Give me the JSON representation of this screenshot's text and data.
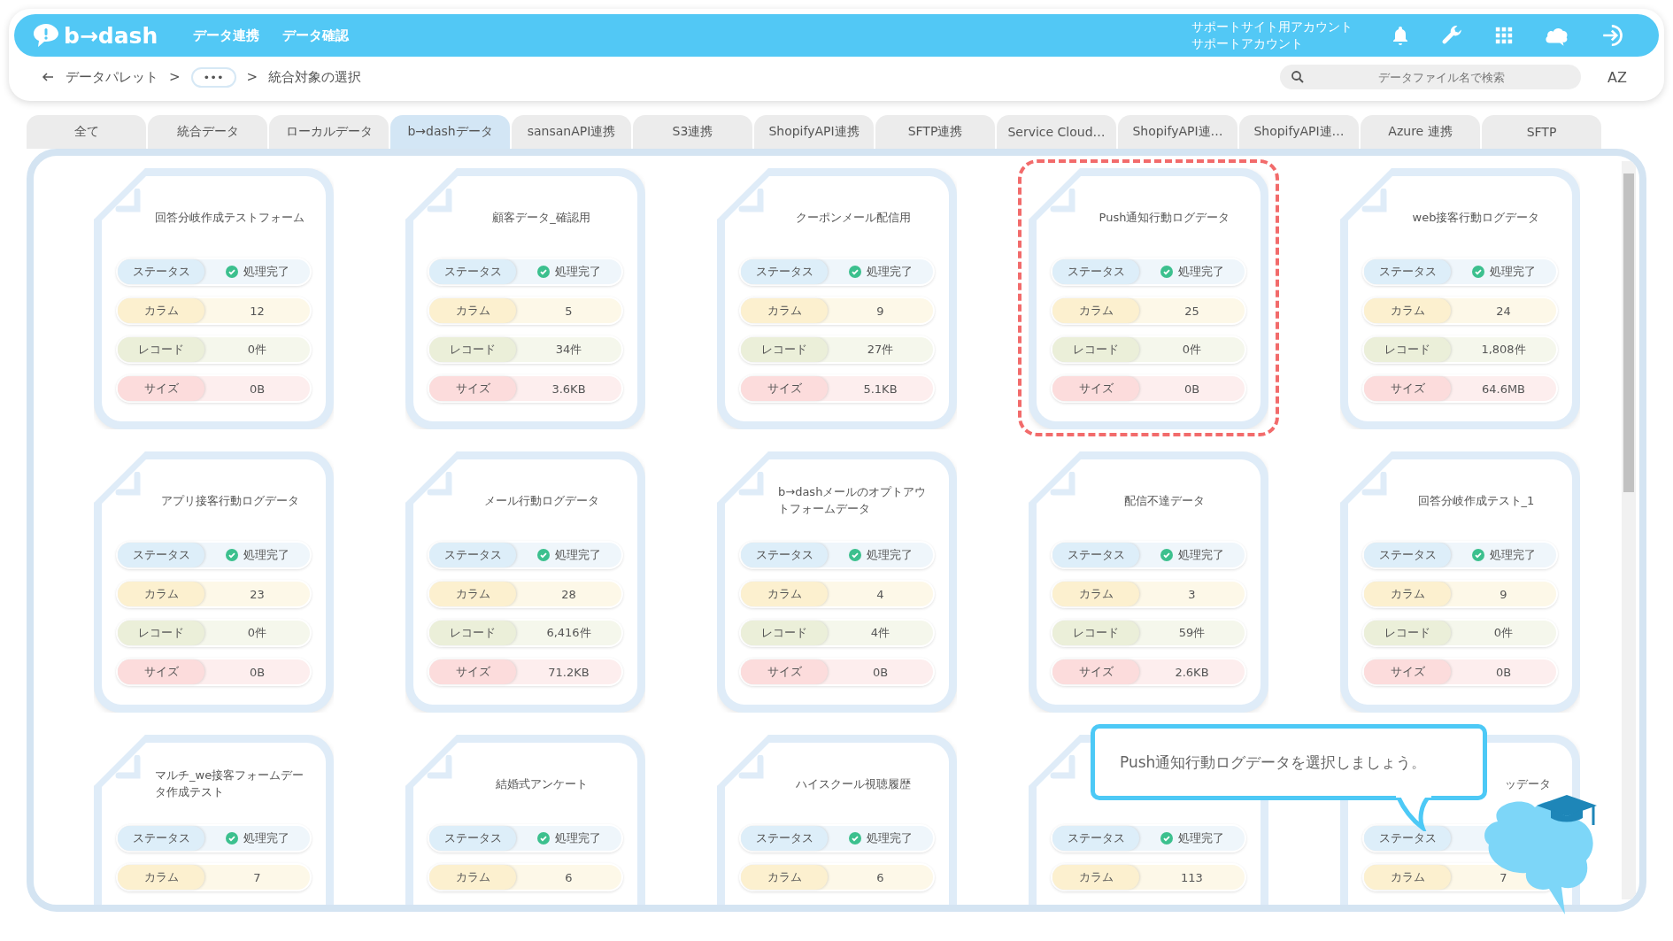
{
  "header": {
    "logo": "b→dash",
    "nav": [
      "データ連携",
      "データ確認"
    ],
    "account": [
      "サポートサイト用アカウント",
      "サポートアカウント"
    ]
  },
  "breadcrumb": {
    "root": "データパレット",
    "sep1": ">",
    "more": "•••",
    "sep2": ">",
    "current": "統合対象の選択"
  },
  "search": {
    "placeholder": "データファイル名で検索"
  },
  "sort_label": "AZ",
  "tabs": [
    {
      "label": "全て",
      "selected": false
    },
    {
      "label": "統合データ",
      "selected": false
    },
    {
      "label": "ローカルデータ",
      "selected": false
    },
    {
      "label": "b→dashデータ",
      "selected": true
    },
    {
      "label": "sansanAPI連携",
      "selected": false
    },
    {
      "label": "S3連携",
      "selected": false
    },
    {
      "label": "ShopifyAPI連携",
      "selected": false
    },
    {
      "label": "SFTP連携",
      "selected": false
    },
    {
      "label": "Service Cloud…",
      "selected": false
    },
    {
      "label": "ShopifyAPI連…",
      "selected": false
    },
    {
      "label": "ShopifyAPI連…",
      "selected": false
    },
    {
      "label": "Azure 連携",
      "selected": false
    },
    {
      "label": "SFTP",
      "selected": false
    }
  ],
  "cards": [
    {
      "title": "回答分岐作成テストフォーム",
      "highlighted": false,
      "stats": [
        {
          "kind": "status",
          "label": "ステータス",
          "value": "処理完了"
        },
        {
          "kind": "columns",
          "label": "カラム",
          "value": "12"
        },
        {
          "kind": "records",
          "label": "レコード",
          "value": "0件"
        },
        {
          "kind": "size",
          "label": "サイズ",
          "value": "0B"
        }
      ]
    },
    {
      "title": "顧客データ_確認用",
      "highlighted": false,
      "stats": [
        {
          "kind": "status",
          "label": "ステータス",
          "value": "処理完了"
        },
        {
          "kind": "columns",
          "label": "カラム",
          "value": "5"
        },
        {
          "kind": "records",
          "label": "レコード",
          "value": "34件"
        },
        {
          "kind": "size",
          "label": "サイズ",
          "value": "3.6KB"
        }
      ]
    },
    {
      "title": "クーポンメール配信用",
      "highlighted": false,
      "stats": [
        {
          "kind": "status",
          "label": "ステータス",
          "value": "処理完了"
        },
        {
          "kind": "columns",
          "label": "カラム",
          "value": "9"
        },
        {
          "kind": "records",
          "label": "レコード",
          "value": "27件"
        },
        {
          "kind": "size",
          "label": "サイズ",
          "value": "5.1KB"
        }
      ]
    },
    {
      "title": "Push通知行動ログデータ",
      "highlighted": true,
      "stats": [
        {
          "kind": "status",
          "label": "ステータス",
          "value": "処理完了"
        },
        {
          "kind": "columns",
          "label": "カラム",
          "value": "25"
        },
        {
          "kind": "records",
          "label": "レコード",
          "value": "0件"
        },
        {
          "kind": "size",
          "label": "サイズ",
          "value": "0B"
        }
      ]
    },
    {
      "title": "web接客行動ログデータ",
      "highlighted": false,
      "stats": [
        {
          "kind": "status",
          "label": "ステータス",
          "value": "処理完了"
        },
        {
          "kind": "columns",
          "label": "カラム",
          "value": "24"
        },
        {
          "kind": "records",
          "label": "レコード",
          "value": "1,808件"
        },
        {
          "kind": "size",
          "label": "サイズ",
          "value": "64.6MB"
        }
      ]
    },
    {
      "title": "アプリ接客行動ログデータ",
      "highlighted": false,
      "stats": [
        {
          "kind": "status",
          "label": "ステータス",
          "value": "処理完了"
        },
        {
          "kind": "columns",
          "label": "カラム",
          "value": "23"
        },
        {
          "kind": "records",
          "label": "レコード",
          "value": "0件"
        },
        {
          "kind": "size",
          "label": "サイズ",
          "value": "0B"
        }
      ]
    },
    {
      "title": "メール行動ログデータ",
      "highlighted": false,
      "stats": [
        {
          "kind": "status",
          "label": "ステータス",
          "value": "処理完了"
        },
        {
          "kind": "columns",
          "label": "カラム",
          "value": "28"
        },
        {
          "kind": "records",
          "label": "レコード",
          "value": "6,416件"
        },
        {
          "kind": "size",
          "label": "サイズ",
          "value": "71.2KB"
        }
      ]
    },
    {
      "title": "b→dashメールのオプトアウトフォームデータ",
      "highlighted": false,
      "stats": [
        {
          "kind": "status",
          "label": "ステータス",
          "value": "処理完了"
        },
        {
          "kind": "columns",
          "label": "カラム",
          "value": "4"
        },
        {
          "kind": "records",
          "label": "レコード",
          "value": "4件"
        },
        {
          "kind": "size",
          "label": "サイズ",
          "value": "0B"
        }
      ]
    },
    {
      "title": "配信不達データ",
      "highlighted": false,
      "stats": [
        {
          "kind": "status",
          "label": "ステータス",
          "value": "処理完了"
        },
        {
          "kind": "columns",
          "label": "カラム",
          "value": "3"
        },
        {
          "kind": "records",
          "label": "レコード",
          "value": "59件"
        },
        {
          "kind": "size",
          "label": "サイズ",
          "value": "2.6KB"
        }
      ]
    },
    {
      "title": "回答分岐作成テスト_1",
      "highlighted": false,
      "stats": [
        {
          "kind": "status",
          "label": "ステータス",
          "value": "処理完了"
        },
        {
          "kind": "columns",
          "label": "カラム",
          "value": "9"
        },
        {
          "kind": "records",
          "label": "レコード",
          "value": "0件"
        },
        {
          "kind": "size",
          "label": "サイズ",
          "value": "0B"
        }
      ]
    },
    {
      "title": "マルチ_we接客フォームデータ作成テスト",
      "highlighted": false,
      "stats": [
        {
          "kind": "status",
          "label": "ステータス",
          "value": "処理完了"
        },
        {
          "kind": "columns",
          "label": "カラム",
          "value": "7"
        }
      ]
    },
    {
      "title": "結婚式アンケート",
      "highlighted": false,
      "stats": [
        {
          "kind": "status",
          "label": "ステータス",
          "value": "処理完了"
        },
        {
          "kind": "columns",
          "label": "カラム",
          "value": "6"
        }
      ]
    },
    {
      "title": "ハイスクール視聴履歴",
      "highlighted": false,
      "stats": [
        {
          "kind": "status",
          "label": "ステータス",
          "value": "処理完了"
        },
        {
          "kind": "columns",
          "label": "カラム",
          "value": "6"
        }
      ]
    },
    {
      "highlighted": false,
      "stats": [
        {
          "kind": "status",
          "label": "ステータス",
          "value": "処理完了"
        },
        {
          "kind": "columns",
          "label": "カラム",
          "value": "113"
        }
      ]
    },
    {
      "title": "ッデータ",
      "title_cut_left": true,
      "highlighted": false,
      "stats": [
        {
          "kind": "status",
          "label": "ステータス"
        },
        {
          "kind": "columns",
          "label": "カラム",
          "value": "7"
        }
      ]
    }
  ],
  "tooltip": {
    "text": "Push通知行動ログデータを選択しましょう。"
  }
}
